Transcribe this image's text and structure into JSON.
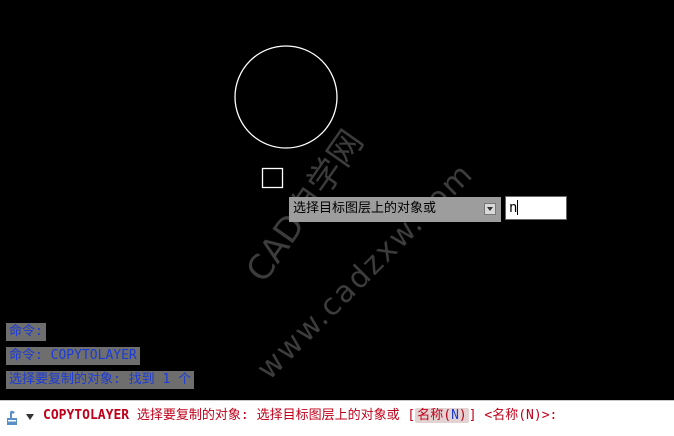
{
  "watermark": {
    "line1": "CAD自学网",
    "line2": "www.cadzxw.com"
  },
  "tooltip": {
    "prompt": "选择目标图层上的对象或"
  },
  "dynamic_input": {
    "value": "n"
  },
  "history": [
    "命令:",
    "命令: COPYTOLAYER",
    "选择要复制的对象: 找到 1 个"
  ],
  "command_line": {
    "command": "COPYTOLAYER",
    "part1": "选择要复制的对象:",
    "part2": "选择目标图层上的对象或",
    "bracket_open": "[",
    "option_label": "名称",
    "option_key_open": "(",
    "option_key": "N",
    "option_key_close": ")",
    "bracket_close": "]",
    "default_text": "<名称(N)>:"
  },
  "colors": {
    "canvas": "#000000",
    "geometry_stroke": "#ffffff",
    "command_text": "#c0001b",
    "history_text": "#1b3bd6"
  }
}
